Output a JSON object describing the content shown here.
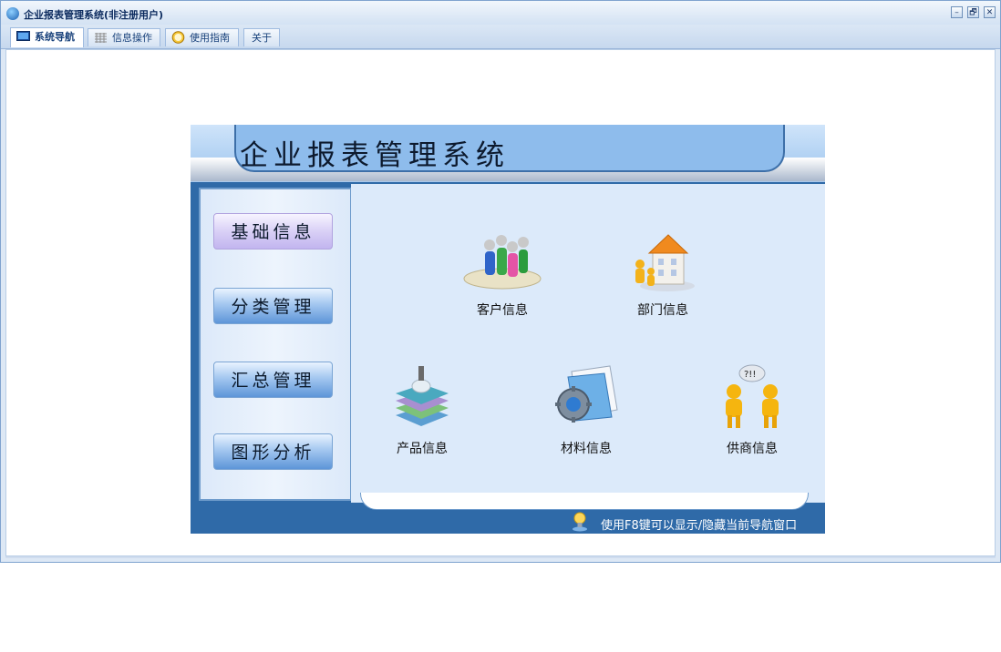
{
  "window": {
    "title": "企业报表管理系统(非注册用户)",
    "controls": {
      "minimize": "–",
      "restore": "🗗",
      "close": "✕"
    }
  },
  "tabs": [
    {
      "label": "系统导航",
      "icon": "monitor-icon",
      "active": true
    },
    {
      "label": "信息操作",
      "icon": "grid-icon",
      "active": false
    },
    {
      "label": "使用指南",
      "icon": "clock-icon",
      "active": false
    },
    {
      "label": "关于",
      "icon": "",
      "active": false
    }
  ],
  "panel": {
    "title": "企业报表管理系统",
    "nav": [
      {
        "label": "基础信息",
        "selected": true
      },
      {
        "label": "分类管理",
        "selected": false
      },
      {
        "label": "汇总管理",
        "selected": false
      },
      {
        "label": "图形分析",
        "selected": false
      }
    ],
    "items": [
      {
        "label": "客户信息",
        "icon": "customers-icon"
      },
      {
        "label": "部门信息",
        "icon": "department-icon"
      },
      {
        "label": "产品信息",
        "icon": "products-icon"
      },
      {
        "label": "材料信息",
        "icon": "materials-icon"
      },
      {
        "label": "供商信息",
        "icon": "suppliers-icon"
      }
    ],
    "hint": "使用F8键可以显示/隐藏当前导航窗口"
  },
  "colors": {
    "accent": "#2f6aa8",
    "banner": "#8ebcec",
    "selected_nav": "#c2b5ef"
  }
}
